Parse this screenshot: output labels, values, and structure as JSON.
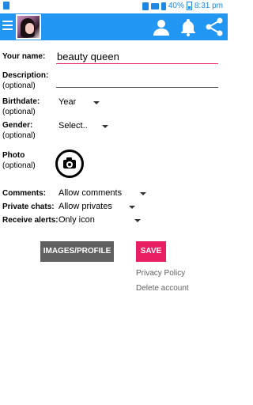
{
  "status_bar": {
    "battery": "40%",
    "time": "8:31 pm"
  },
  "app_bar": {
    "color": "#2196f3",
    "icons": [
      "menu-icon",
      "profile-icon",
      "bell-icon",
      "share-icon"
    ]
  },
  "form": {
    "name": {
      "label": "Your name:",
      "value": "beauty queen"
    },
    "description": {
      "label": "Description:",
      "optional": "(optional)",
      "value": ""
    },
    "birthdate": {
      "label": "Birthdate:",
      "optional": "(optional)",
      "value": "Year"
    },
    "gender": {
      "label": "Gender:",
      "optional": "(optional)",
      "value": "Select.."
    },
    "photo": {
      "label": "Photo",
      "optional": "(optional)"
    },
    "comments": {
      "label": "Comments:",
      "value": "Allow comments"
    },
    "private_chats": {
      "label": "Private chats:",
      "value": "Allow privates"
    },
    "receive_alerts": {
      "label": "Receive alerts:",
      "value": "Only icon"
    }
  },
  "buttons": {
    "images_profile": "IMAGES/PROFILE",
    "save": "SAVE"
  },
  "links": {
    "privacy_policy": "Privacy Policy",
    "delete_account": "Delete account"
  },
  "colors": {
    "accent": "#e91e63",
    "primary": "#2196f3",
    "button_gray": "#616161"
  }
}
